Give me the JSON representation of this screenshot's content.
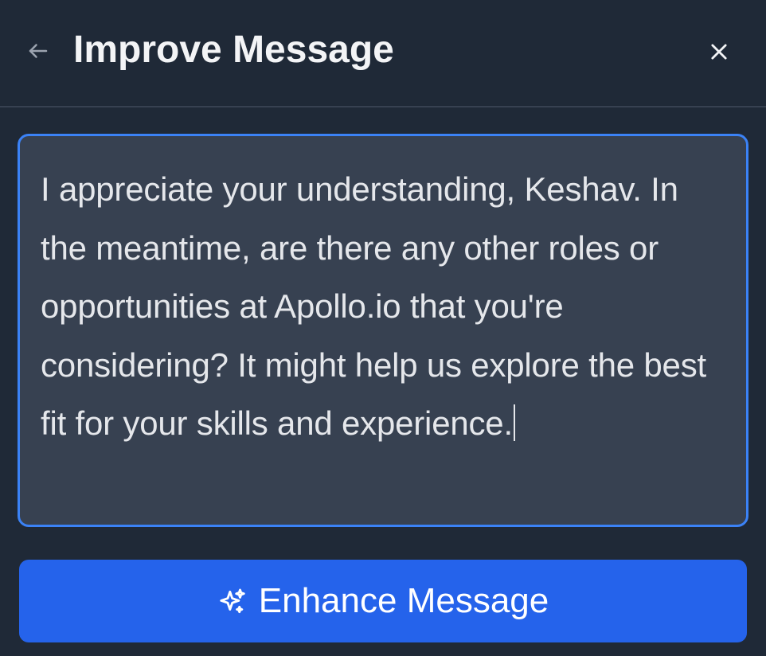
{
  "header": {
    "title": "Improve Message",
    "back_icon": "arrow-left-icon",
    "close_icon": "close-icon"
  },
  "editor": {
    "value": "I appreciate your understanding, Keshav. In the meantime, are there any other roles or opportunities at Apollo.io that you're considering? It might help us explore the best fit for your skills and experience."
  },
  "actions": {
    "enhance_label": "Enhance Message",
    "enhance_icon": "sparkles-icon"
  },
  "colors": {
    "background": "#1f2937",
    "editor_background": "#374151",
    "focus_border": "#3b82f6",
    "primary_button": "#2563eb",
    "title_text": "#f3f4f6",
    "muted_icon": "#9ca3af"
  }
}
